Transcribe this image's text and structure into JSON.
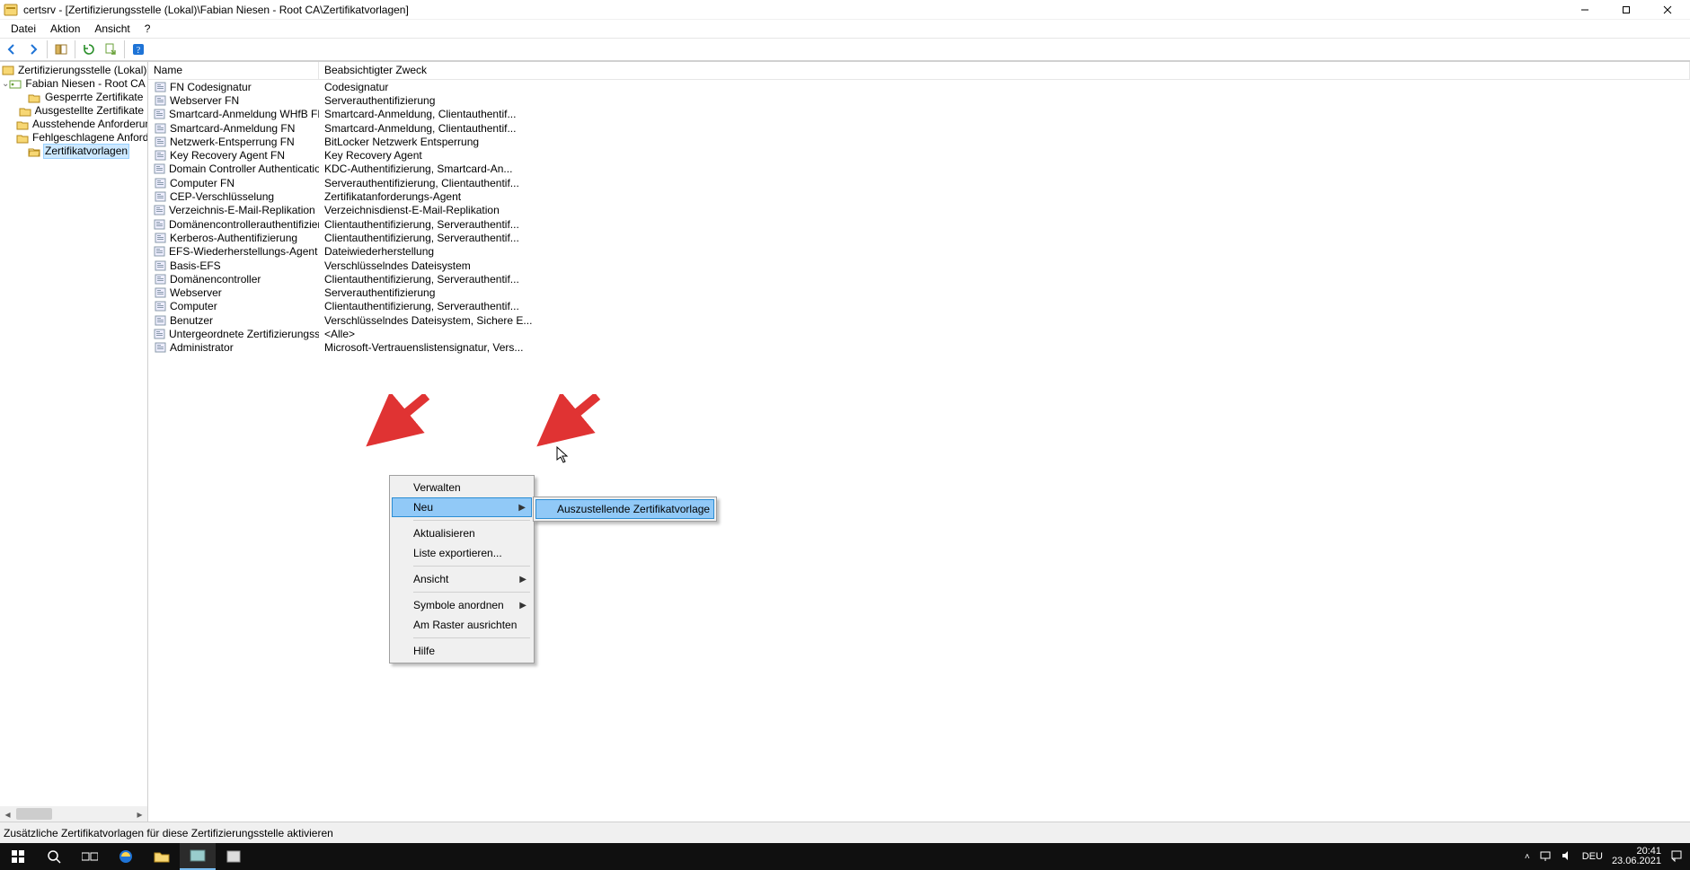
{
  "window": {
    "title": "certsrv - [Zertifizierungsstelle (Lokal)\\Fabian Niesen - Root CA\\Zertifikatvorlagen]"
  },
  "menubar": [
    "Datei",
    "Aktion",
    "Ansicht",
    "?"
  ],
  "tree": {
    "root": {
      "label": "Zertifizierungsstelle (Lokal)"
    },
    "ca": {
      "label": "Fabian Niesen - Root CA"
    },
    "nodes": [
      {
        "label": "Gesperrte Zertifikate"
      },
      {
        "label": "Ausgestellte Zertifikate"
      },
      {
        "label": "Ausstehende Anforderungen"
      },
      {
        "label": "Fehlgeschlagene Anforderungen"
      },
      {
        "label": "Zertifikatvorlagen",
        "selected": true
      }
    ]
  },
  "list": {
    "columns": {
      "name": "Name",
      "purpose": "Beabsichtigter Zweck"
    },
    "rows": [
      {
        "name": "FN Codesignatur",
        "purpose": "Codesignatur"
      },
      {
        "name": "Webserver FN",
        "purpose": "Serverauthentifizierung"
      },
      {
        "name": "Smartcard-Anmeldung WHfB FN",
        "purpose": "Smartcard-Anmeldung, Clientauthentif..."
      },
      {
        "name": "Smartcard-Anmeldung FN",
        "purpose": "Smartcard-Anmeldung, Clientauthentif..."
      },
      {
        "name": "Netzwerk-Entsperrung FN",
        "purpose": "BitLocker Netzwerk Entsperrung"
      },
      {
        "name": "Key Recovery Agent FN",
        "purpose": "Key Recovery Agent"
      },
      {
        "name": "Domain Controller Authentication (K...",
        "purpose": "KDC-Authentifizierung, Smartcard-An..."
      },
      {
        "name": "Computer FN",
        "purpose": "Serverauthentifizierung, Clientauthentif..."
      },
      {
        "name": "CEP-Verschlüsselung",
        "purpose": "Zertifikatanforderungs-Agent"
      },
      {
        "name": "Verzeichnis-E-Mail-Replikation",
        "purpose": "Verzeichnisdienst-E-Mail-Replikation"
      },
      {
        "name": "Domänencontrollerauthentifizierung",
        "purpose": "Clientauthentifizierung, Serverauthentif..."
      },
      {
        "name": "Kerberos-Authentifizierung",
        "purpose": "Clientauthentifizierung, Serverauthentif..."
      },
      {
        "name": "EFS-Wiederherstellungs-Agent",
        "purpose": "Dateiwiederherstellung"
      },
      {
        "name": "Basis-EFS",
        "purpose": "Verschlüsselndes Dateisystem"
      },
      {
        "name": "Domänencontroller",
        "purpose": "Clientauthentifizierung, Serverauthentif..."
      },
      {
        "name": "Webserver",
        "purpose": "Serverauthentifizierung"
      },
      {
        "name": "Computer",
        "purpose": "Clientauthentifizierung, Serverauthentif..."
      },
      {
        "name": "Benutzer",
        "purpose": "Verschlüsselndes Dateisystem, Sichere E..."
      },
      {
        "name": "Untergeordnete Zertifizierungsstelle",
        "purpose": "<Alle>"
      },
      {
        "name": "Administrator",
        "purpose": "Microsoft-Vertrauenslistensignatur, Vers..."
      }
    ]
  },
  "context_menu": {
    "items": [
      {
        "label": "Verwalten"
      },
      {
        "label": "Neu",
        "submenu": true,
        "highlight": true
      },
      {
        "sep": true
      },
      {
        "label": "Aktualisieren"
      },
      {
        "label": "Liste exportieren..."
      },
      {
        "sep": true
      },
      {
        "label": "Ansicht",
        "submenu": true
      },
      {
        "sep": true
      },
      {
        "label": "Symbole anordnen",
        "submenu": true
      },
      {
        "label": "Am Raster ausrichten"
      },
      {
        "sep": true
      },
      {
        "label": "Hilfe"
      }
    ],
    "submenu": {
      "label": "Auszustellende Zertifikatvorlage",
      "highlight": true
    }
  },
  "statusbar": "Zusätzliche Zertifikatvorlagen für diese Zertifizierungsstelle aktivieren",
  "tray": {
    "time": "20:41",
    "date": "23.06.2021",
    "lang": "DEU"
  }
}
